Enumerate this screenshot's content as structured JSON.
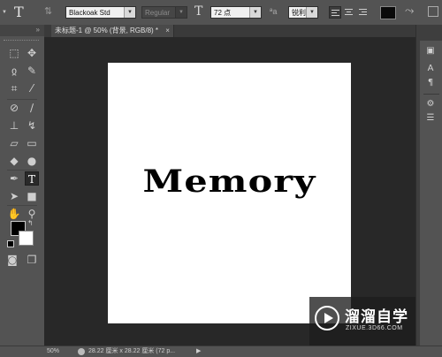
{
  "options_bar": {
    "tool_glyph": "T",
    "font_family": "Blackoak Std",
    "font_style": "Regular",
    "font_size": "72 点",
    "antialias_label": "a",
    "antialias_value": "锐利",
    "text_color": "#000000"
  },
  "document_tab": {
    "title": "未标题-1 @ 50% (背景, RGB/8) *",
    "close": "×"
  },
  "toolbar": {
    "collapse": "»",
    "foreground_color": "#000000",
    "background_color": "#ffffff"
  },
  "canvas": {
    "text_layer": "Memory",
    "background": "#ffffff"
  },
  "status_bar": {
    "zoom": "50%",
    "doc_info": "28.22 厘米 x 28.22 厘米 (72 p...",
    "arrow": "▶"
  },
  "watermark": {
    "title": "溜溜自学",
    "url": "ZIXUE.3D66.COM"
  }
}
